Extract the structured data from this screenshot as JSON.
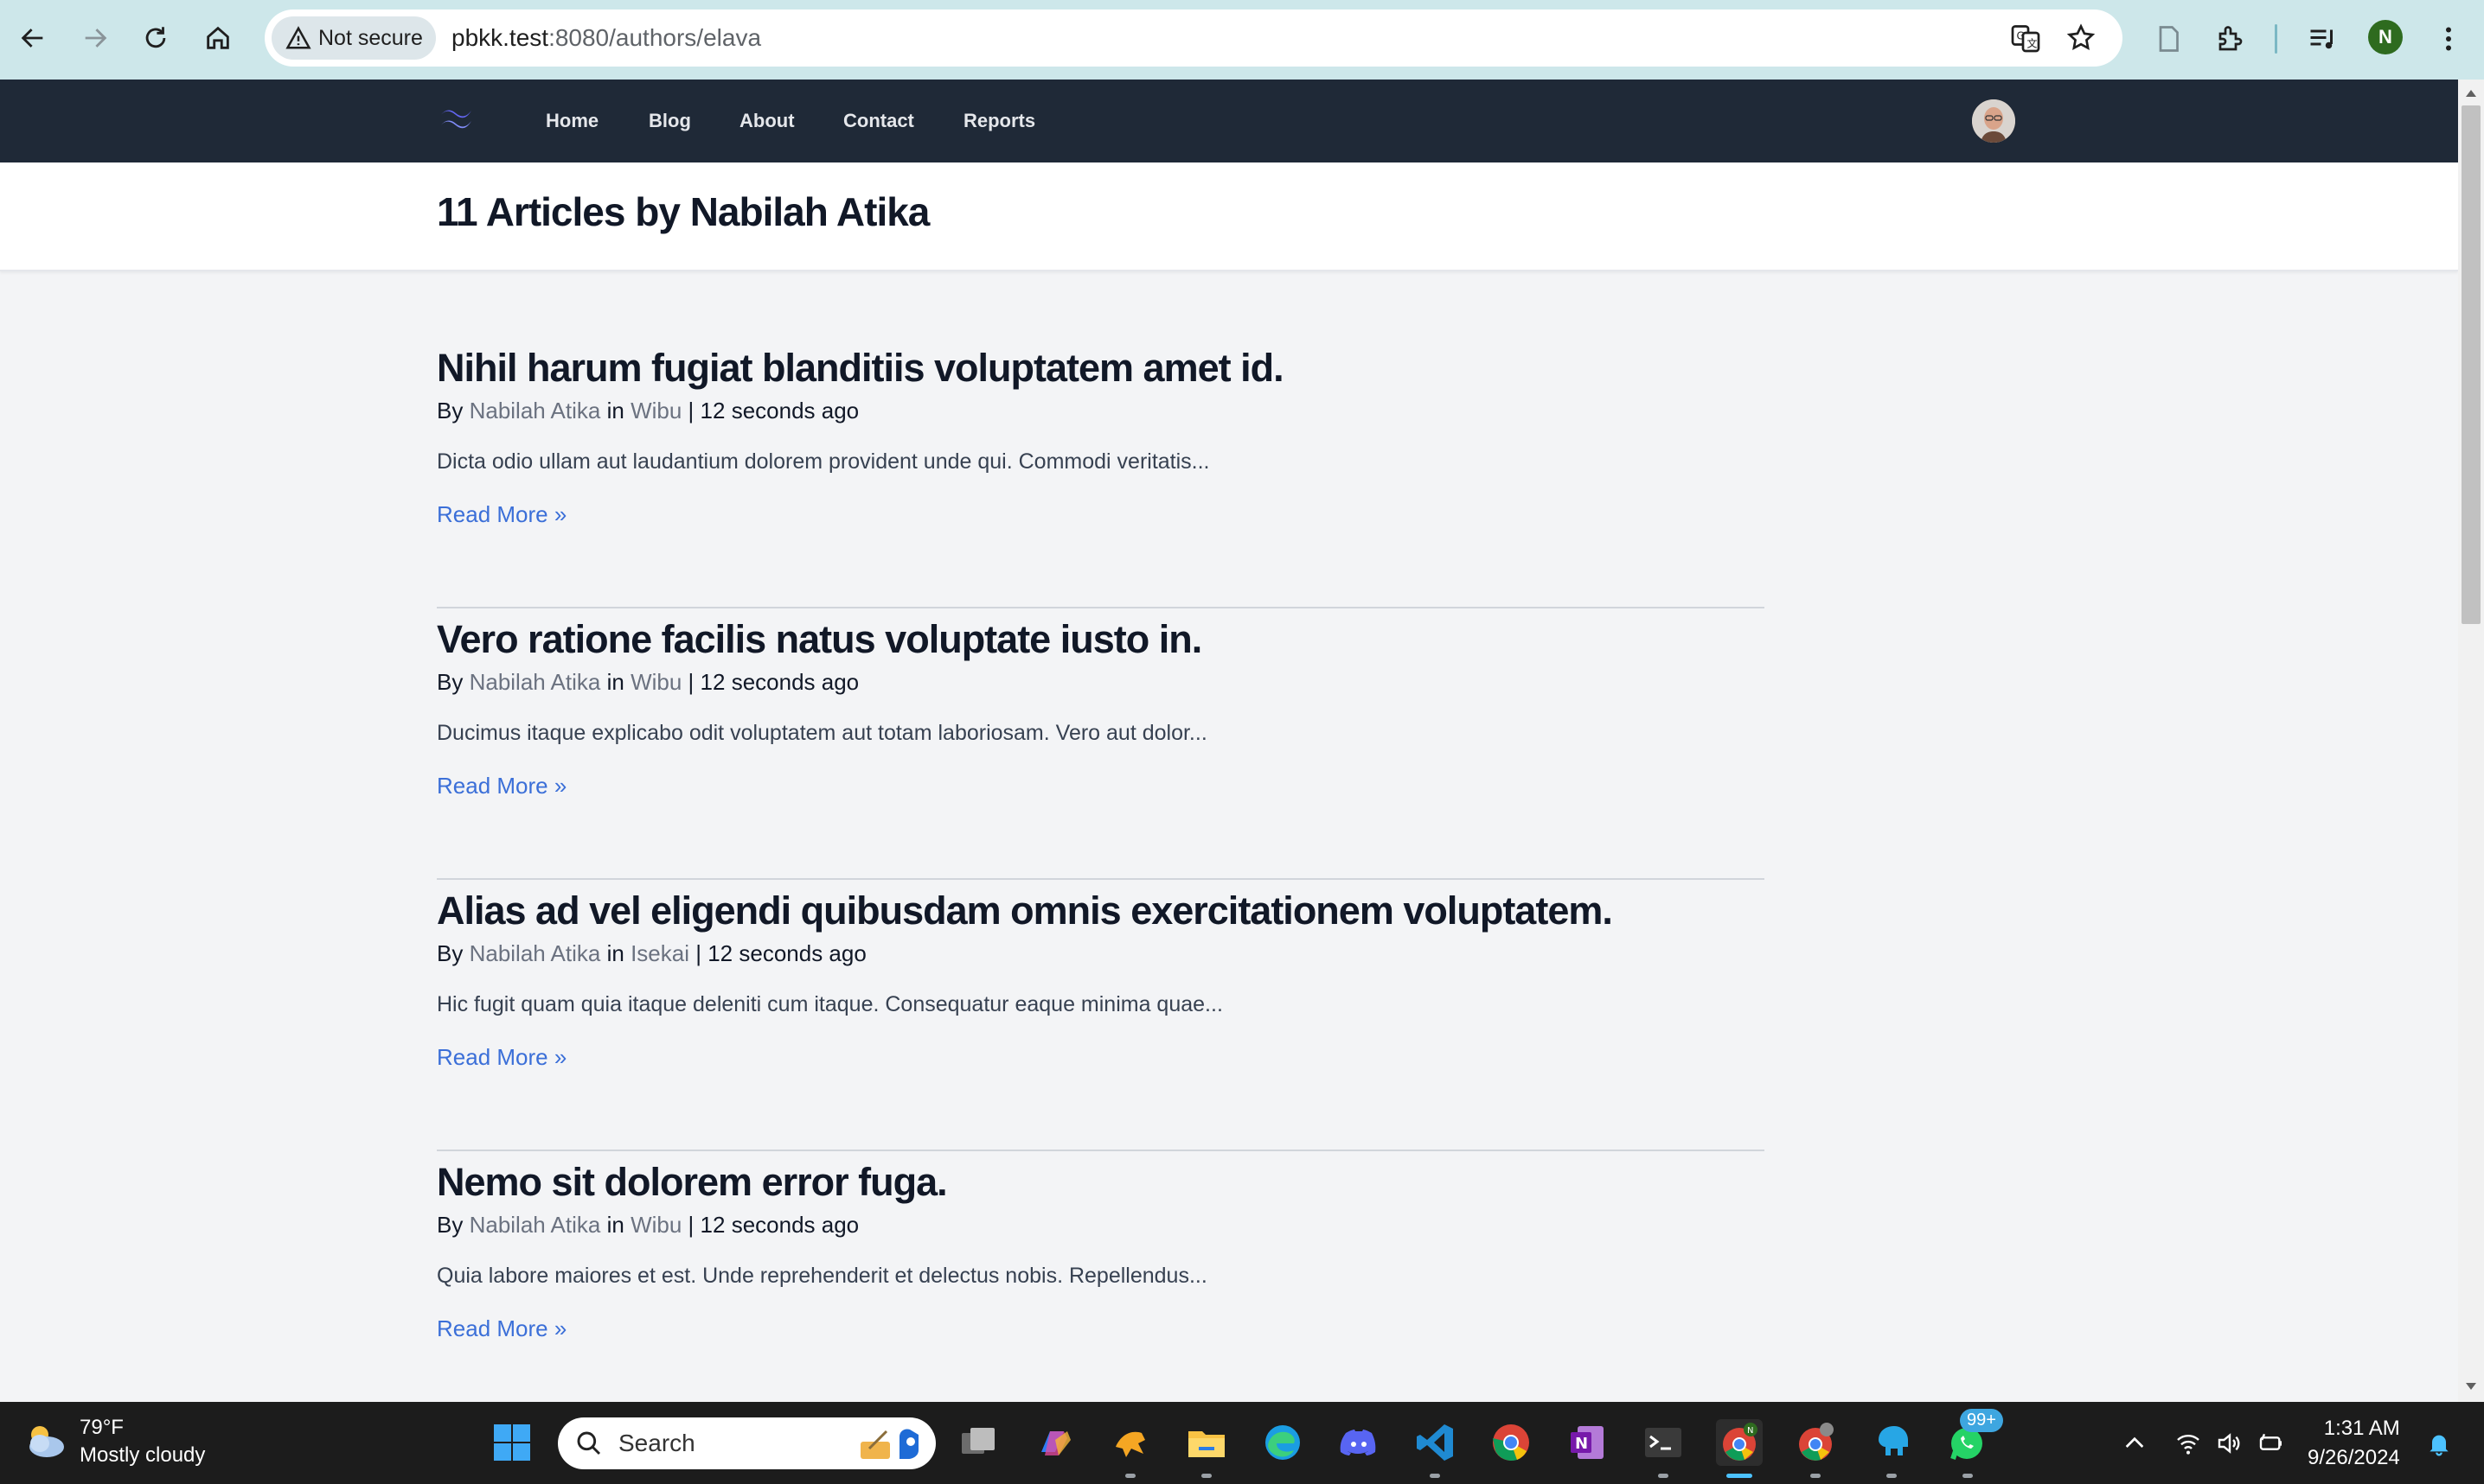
{
  "browser": {
    "security_label": "Not secure",
    "url_host": "pbkk.test",
    "url_path": ":8080/authors/elava",
    "profile_initial": "N"
  },
  "nav": {
    "links": [
      "Home",
      "Blog",
      "About",
      "Contact",
      "Reports"
    ]
  },
  "header": {
    "title": "11 Articles by Nabilah Atika"
  },
  "articles": [
    {
      "title": "Nihil harum fugiat blanditiis voluptatem amet id.",
      "by": "By",
      "author": "Nabilah Atika",
      "in": "in",
      "category": "Wibu",
      "sep": "|",
      "time": "12 seconds ago",
      "excerpt": "Dicta odio ullam aut laudantium dolorem provident unde qui. Commodi veritatis...",
      "read_more": "Read More »"
    },
    {
      "title": "Vero ratione facilis natus voluptate iusto in.",
      "by": "By",
      "author": "Nabilah Atika",
      "in": "in",
      "category": "Wibu",
      "sep": "|",
      "time": "12 seconds ago",
      "excerpt": "Ducimus itaque explicabo odit voluptatem aut totam laboriosam. Vero aut dolor...",
      "read_more": "Read More »"
    },
    {
      "title": "Alias ad vel eligendi quibusdam omnis exercitationem voluptatem.",
      "by": "By",
      "author": "Nabilah Atika",
      "in": "in",
      "category": "Isekai",
      "sep": "|",
      "time": "12 seconds ago",
      "excerpt": "Hic fugit quam quia itaque deleniti cum itaque. Consequatur eaque minima quae...",
      "read_more": "Read More »"
    },
    {
      "title": "Nemo sit dolorem error fuga.",
      "by": "By",
      "author": "Nabilah Atika",
      "in": "in",
      "category": "Wibu",
      "sep": "|",
      "time": "12 seconds ago",
      "excerpt": "Quia labore maiores et est. Unde reprehenderit et delectus nobis. Repellendus...",
      "read_more": "Read More »"
    }
  ],
  "taskbar": {
    "weather_temp": "79°F",
    "weather_desc": "Mostly cloudy",
    "search_placeholder": "Search",
    "whatsapp_badge": "99+",
    "time": "1:31 AM",
    "date": "9/26/2024"
  },
  "colors": {
    "nav_bg": "#1f2937",
    "page_bg": "#f3f4f6",
    "link_blue": "#3b6fd8",
    "chrome_bg": "#cde7ea"
  }
}
